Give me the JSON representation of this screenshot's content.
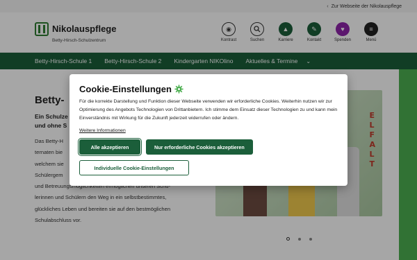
{
  "topbar": {
    "link": "Zur Webseite der Nikolauspflege"
  },
  "logo": {
    "name": "Nikolauspflege",
    "subtitle": "Betty-Hirsch-Schulzentrum"
  },
  "header_icons": [
    {
      "label": "Kontrast",
      "icon": "contrast-icon"
    },
    {
      "label": "Suchen",
      "icon": "search-icon"
    },
    {
      "label": "Karriere",
      "icon": "graduation-cap-icon"
    },
    {
      "label": "Kontakt",
      "icon": "contact-icon"
    },
    {
      "label": "Spenden",
      "icon": "heart-icon"
    },
    {
      "label": "Menü",
      "icon": "menu-icon"
    }
  ],
  "nav": {
    "items": [
      "Betty-Hirsch-Schule 1",
      "Betty-Hirsch-Schule 2",
      "Kindergarten NIKOlino",
      "Aktuelles & Termine"
    ]
  },
  "main": {
    "heading": "Betty-",
    "subheading_line1": "Ein Schulze",
    "subheading_line2": "und ohne S",
    "body_lines": [
      "Das Betty-H",
      "ternaten bie",
      "welchem sie",
      "Schülergem",
      "und Betreuungsmöglichkeiten ermöglichen unseren Schu-",
      "lerinnen und Schülern den Weg in ein selbstbestimmtes,",
      "glückliches Leben und bereiten sie auf den bestmöglichen",
      "Schulabschluss vor."
    ],
    "photo_letters": "E\nL\nF\nA\nL\nT"
  },
  "cookie": {
    "title": "Cookie-Einstellungen",
    "text": "Für die korrekte Darstellung und Funktion dieser Webseite verwenden wir erforderliche Cookies. Weiterhin nutzen wir zur Optimierung des Angebots Technologien von Drittanbietern. Ich stimme dem Einsatz dieser Technologien zu und kann mein Einverständnis mit Wirkung für die Zukunft jederzeit widerrufen oder ändern.",
    "link": "Weitere Informationen",
    "accept_all": "Alle akzeptieren",
    "accept_required": "Nur erforderliche Cookies akzeptieren",
    "individual": "Individuelle Cookie-Einstellungen"
  },
  "colors": {
    "brand_green": "#1b5e3a",
    "accent_green": "#4caf50",
    "purple": "#8e24aa"
  }
}
